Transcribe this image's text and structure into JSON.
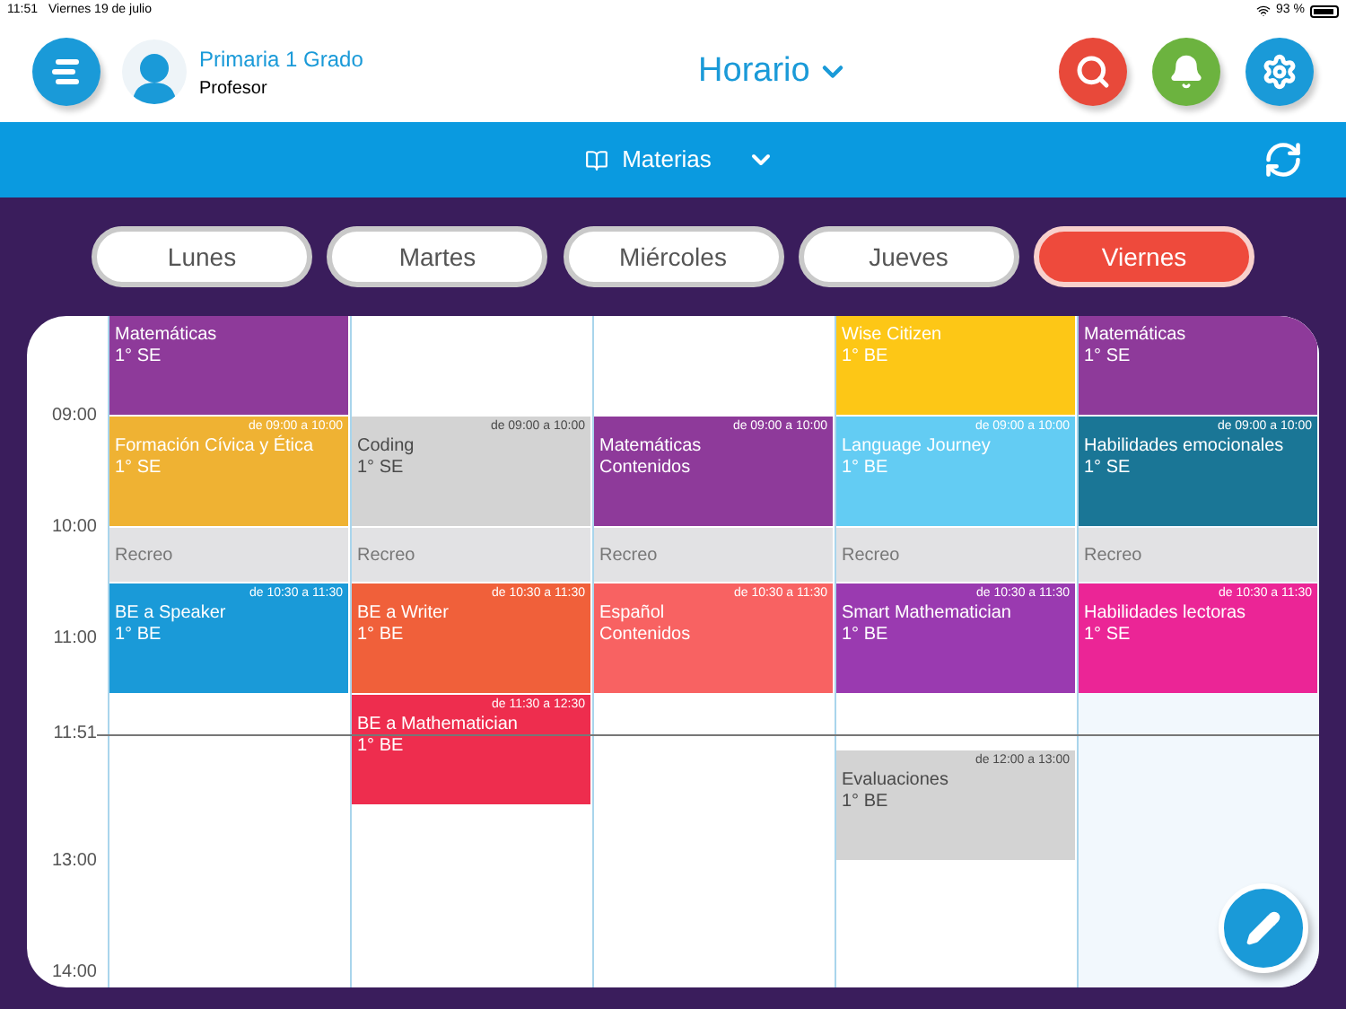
{
  "status_bar": {
    "time": "11:51",
    "date": "Viernes 19 de julio",
    "battery": "93 %"
  },
  "header": {
    "user_name": "Primaria 1 Grado",
    "user_role": "Profesor",
    "title": "Horario"
  },
  "subbar": {
    "label": "Materias"
  },
  "hours": [
    {
      "label": "09:00"
    },
    {
      "label": "10:00"
    },
    {
      "label": "11:00"
    },
    {
      "label": "13:00"
    },
    {
      "label": "14:00"
    }
  ],
  "now": {
    "label": "11:51"
  },
  "days": [
    {
      "label": "Lunes",
      "selected": false,
      "events": [
        {
          "kind": "class",
          "title": "Matemáticas",
          "group": "1° SE",
          "color": "#8e3a9a"
        },
        {
          "kind": "class",
          "title": "Formación Cívica y Ética",
          "group": "1° SE",
          "time": "de 09:00 a 10:00",
          "color": "#efb233"
        },
        {
          "kind": "break",
          "title": "Recreo"
        },
        {
          "kind": "class",
          "title": "BE a Speaker",
          "group": "1° BE",
          "time": "de 10:30 a 11:30",
          "color": "#1a9ad8"
        }
      ]
    },
    {
      "label": "Martes",
      "selected": false,
      "events": [
        {
          "kind": "class",
          "title": "Coding",
          "group": "1° SE",
          "time": "de 09:00 a 10:00",
          "color": "#d3d3d3"
        },
        {
          "kind": "break",
          "title": "Recreo"
        },
        {
          "kind": "class",
          "title": "BE a Writer",
          "group": "1° BE",
          "time": "de 10:30 a 11:30",
          "color": "#f0603a"
        },
        {
          "kind": "class",
          "title": "BE a Mathematician",
          "group": "1° BE",
          "time": "de 11:30 a 12:30",
          "color": "#ee2d4e"
        }
      ]
    },
    {
      "label": "Miércoles",
      "selected": false,
      "events": [
        {
          "kind": "class",
          "title": "Matemáticas",
          "group": "Contenidos",
          "time": "de 09:00 a 10:00",
          "color": "#8e3a9a"
        },
        {
          "kind": "break",
          "title": "Recreo"
        },
        {
          "kind": "class",
          "title": "Español",
          "group": "Contenidos",
          "time": "de 10:30 a 11:30",
          "color": "#f86262"
        }
      ]
    },
    {
      "label": "Jueves",
      "selected": false,
      "events": [
        {
          "kind": "class",
          "title": "Wise Citizen",
          "group": "1° BE",
          "color": "#fdc716"
        },
        {
          "kind": "class",
          "title": "Language Journey",
          "group": "1° BE",
          "time": "de 09:00 a 10:00",
          "color": "#63ccf3"
        },
        {
          "kind": "break",
          "title": "Recreo"
        },
        {
          "kind": "class",
          "title": "Smart Mathematician",
          "group": "1° BE",
          "time": "de 10:30 a 11:30",
          "color": "#9a3ab0"
        },
        {
          "kind": "class",
          "title": "Evaluaciones",
          "group": "1° BE",
          "time": "de 12:00 a 13:00",
          "color": "#d3d3d3"
        }
      ]
    },
    {
      "label": "Viernes",
      "selected": true,
      "events": [
        {
          "kind": "class",
          "title": "Matemáticas",
          "group": "1° SE",
          "color": "#8e3a9a"
        },
        {
          "kind": "class",
          "title": "Habilidades emocionales",
          "group": "1° SE",
          "time": "de 09:00 a 10:00",
          "color": "#1a7696"
        },
        {
          "kind": "break",
          "title": "Recreo"
        },
        {
          "kind": "class",
          "title": "Habilidades lectoras",
          "group": "1° SE",
          "time": "de 10:30 a 11:30",
          "color": "#eb2596"
        }
      ]
    }
  ]
}
